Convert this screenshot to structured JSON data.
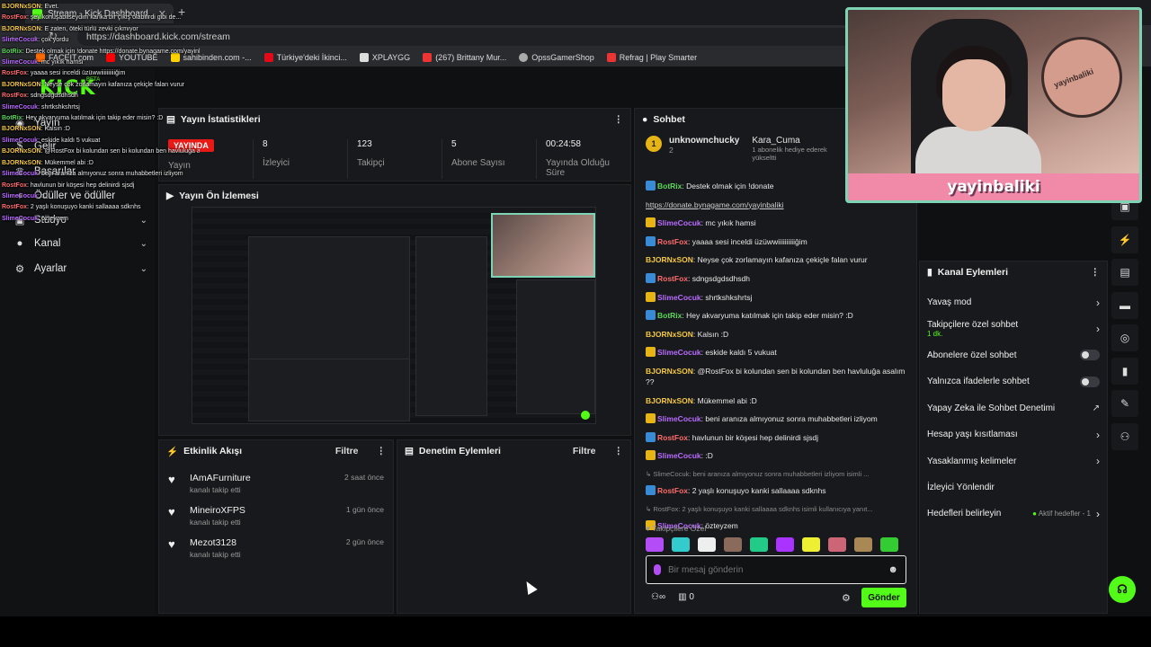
{
  "browser": {
    "tab_title": "Stream - Kick Dashboard",
    "url": "https://dashboard.kick.com/stream",
    "bookmarks": [
      "FACEIT.com",
      "YOUTUBE",
      "sahibinden.com -...",
      "Türkiye'deki İkinci...",
      "XPLAYGG",
      "(267) Brittany Mur...",
      "OpssGamerShop",
      "Refrag | Play Smarter"
    ]
  },
  "logo": {
    "text": "KICK",
    "beta": "BETA"
  },
  "sidebar": {
    "items": [
      {
        "label": "Yayın",
        "icon": "broadcast-icon"
      },
      {
        "label": "Gelir",
        "icon": "wallet-icon"
      },
      {
        "label": "Başarılar",
        "icon": "trophy-icon"
      },
      {
        "label": "Ödüller ve ödüller",
        "icon": "gift-icon"
      },
      {
        "label": "Stüdyo",
        "icon": "studio-icon"
      },
      {
        "label": "Kanal",
        "icon": "user-icon"
      },
      {
        "label": "Ayarlar",
        "icon": "gear-icon"
      }
    ]
  },
  "overlay_chat": [
    {
      "user": "BJORNxSON",
      "text": ": Evet.",
      "color": "#f5c842"
    },
    {
      "user": "RostFox",
      "text": ": şey konuşabilseydim kanka bir çıkış olabilirdi gibi de...",
      "color": "#ff6b6b"
    },
    {
      "user": "BJORNxSON",
      "text": ": E zaten, öteki türlü zevki çıkmıyor",
      "color": "#f5c842"
    },
    {
      "user": "SlimeCocuk",
      "text": ": çok yordu",
      "color": "#b86bff"
    },
    {
      "user": "BotRix",
      "text": ": Destek olmak için !donate https://donate.bynagame.com/yayinbaliki",
      "color": "#5ad65a"
    },
    {
      "user": "SlimeCocuk",
      "text": ": mc yıkık hamsi",
      "color": "#b86bff"
    },
    {
      "user": "RostFox",
      "text": ": yaaaa sesi inceldi üzüwwiiiiiiiiiiğim",
      "color": "#ff6b6b"
    },
    {
      "user": "BJORNxSON",
      "text": ": Neyse çok zorlamayın kafanıza çekiçle falan vurur",
      "color": "#f5c842"
    },
    {
      "user": "RostFox",
      "text": ": sdngsdgdsdhsdh",
      "color": "#ff6b6b"
    },
    {
      "user": "SlimeCocuk",
      "text": ": shrtkshkshrtsj",
      "color": "#b86bff"
    },
    {
      "user": "BotRix",
      "text": ": Hey akvaryuma katılmak için takip eder misin? :D",
      "color": "#5ad65a"
    },
    {
      "user": "BJORNxSON",
      "text": ": Kalsın :D",
      "color": "#f5c842"
    },
    {
      "user": "SlimeCocuk",
      "text": ": eskide kaldı 5 vukuat",
      "color": "#b86bff"
    },
    {
      "user": "BJORNxSON",
      "text": ": @RostFox bi kolundan sen bi kolundan ben havluluğa asalım ??",
      "color": "#f5c842"
    },
    {
      "user": "BJORNxSON",
      "text": ": Mükemmel abi :D",
      "color": "#f5c842"
    },
    {
      "user": "SlimeCocuk",
      "text": ": beni aranıza almıyonuz sonra muhabbetleri izliyom",
      "color": "#b86bff"
    },
    {
      "user": "RostFox",
      "text": ": havlunun bir köşesi hep delinirdi sjsdj",
      "color": "#ff6b6b"
    },
    {
      "user": "SlimeCocuk",
      "text": ": :D",
      "color": "#b86bff"
    },
    {
      "user": "RostFox",
      "text": ": 2 yaşlı konuşuyo kanki sallaaaa sdknhs",
      "color": "#ff6b6b"
    },
    {
      "user": "SlimeCocuk",
      "text": ": özteyzem",
      "color": "#b86bff"
    }
  ],
  "stats_panel": {
    "title": "Yayın İstatistikleri",
    "live_badge": "YAYINDA",
    "live_label": "Yayın",
    "stats": [
      {
        "value": "8",
        "label": "İzleyici"
      },
      {
        "value": "123",
        "label": "Takipçi"
      },
      {
        "value": "5",
        "label": "Abone Sayısı"
      },
      {
        "value": "00:24:58",
        "label": "Yayında Olduğu Süre"
      }
    ]
  },
  "preview_panel": {
    "title": "Yayın Ön İzlemesi"
  },
  "activity_panel": {
    "title": "Etkinlik Akışı",
    "filter": "Filtre",
    "items": [
      {
        "name": "IAmAFurniture",
        "sub": "kanalı takip etti",
        "time": "2 saat önce"
      },
      {
        "name": "MineiroXFPS",
        "sub": "kanalı takip etti",
        "time": "1 gün önce"
      },
      {
        "name": "Mezot3128",
        "sub": "kanalı takip etti",
        "time": "2 gün önce"
      }
    ]
  },
  "moderation_panel": {
    "title": "Denetim Eylemleri",
    "filter": "Filtre"
  },
  "chat": {
    "title": "Sohbet",
    "pinned_user": "unknownchucky",
    "pinned_count": "2",
    "gift_user": "Kara_Cuma",
    "gift_text": "1 abonelik hediye ederek yükseltti",
    "messages": [
      {
        "user": "BotRix",
        "text": ": Destek olmak için !donate",
        "color": "#5ad65a",
        "badge": "#3a8bd6"
      },
      {
        "user": "",
        "text": "https://donate.bynagame.com/yayinbaliki",
        "color": "#5ad65a",
        "badge": "",
        "link": true
      },
      {
        "user": "SlimeCocuk",
        "text": ": mc yıkık hamsi",
        "color": "#b86bff",
        "badge": "#e7b416"
      },
      {
        "user": "RostFox",
        "text": ": yaaaa sesi inceldi üzüwwiiiiiiiiiiğim",
        "color": "#ff6b6b",
        "badge": "#3a8bd6"
      },
      {
        "user": "BJORNxSON",
        "text": ": Neyse çok zorlamayın kafanıza çekiçle falan vurur",
        "color": "#f5c842",
        "badge": ""
      },
      {
        "user": "RostFox",
        "text": ": sdngsdgdsdhsdh",
        "color": "#ff6b6b",
        "badge": "#3a8bd6"
      },
      {
        "user": "SlimeCocuk",
        "text": ": shrtkshkshrtsj",
        "color": "#b86bff",
        "badge": "#e7b416"
      },
      {
        "user": "BotRix",
        "text": ": Hey akvaryuma katılmak için takip eder misin? :D",
        "color": "#5ad65a",
        "badge": "#3a8bd6"
      },
      {
        "user": "BJORNxSON",
        "text": ": Kalsın :D",
        "color": "#f5c842",
        "badge": ""
      },
      {
        "user": "SlimeCocuk",
        "text": ": eskide kaldı 5 vukuat",
        "color": "#b86bff",
        "badge": "#e7b416"
      },
      {
        "user": "BJORNxSON",
        "text": ": @RostFox bi kolundan sen bi kolundan ben havluluğa asalım ??",
        "color": "#f5c842",
        "badge": ""
      },
      {
        "user": "BJORNxSON",
        "text": ": Mükemmel abi :D",
        "color": "#f5c842",
        "badge": ""
      },
      {
        "user": "SlimeCocuk",
        "text": ": beni aranıza almıyonuz sonra muhabbetleri izliyom",
        "color": "#b86bff",
        "badge": "#e7b416"
      },
      {
        "user": "RostFox",
        "text": ": havlunun bir köşesi hep delinirdi sjsdj",
        "color": "#ff6b6b",
        "badge": "#3a8bd6"
      },
      {
        "user": "SlimeCocuk",
        "text": ": :D",
        "color": "#b86bff",
        "badge": "#e7b416"
      },
      {
        "user": "",
        "text": "↳ SlimeCocuk: beni aranıza almıyonuz sonra muhabbetleri izliyom isimli ...",
        "color": "",
        "badge": "",
        "reply": true
      },
      {
        "user": "RostFox",
        "text": ": 2 yaşlı konuşuyo kanki sallaaaa sdknhs",
        "color": "#ff6b6b",
        "badge": "#3a8bd6"
      },
      {
        "user": "",
        "text": "↳ RostFox: 2 yaşlı konuşuyo kanki sallaaaa sdknhs isimli kullanıcıya yanıt...",
        "color": "",
        "badge": "",
        "reply": true
      },
      {
        "user": "SlimeCocuk",
        "text": ": özteyzem",
        "color": "#b86bff",
        "badge": "#e7b416"
      }
    ],
    "followers_only_label": "Takipçilere Özel",
    "input_placeholder": "Bir mesaj gönderin",
    "points": "0",
    "send_label": "Gönder"
  },
  "channel_actions": {
    "title": "Kanal Eylemleri",
    "rows": [
      {
        "label": "Yavaş mod",
        "type": "chevron"
      },
      {
        "label": "Takipçilere özel sohbet",
        "sub": "1 dk.",
        "type": "chevron"
      },
      {
        "label": "Abonelere özel sohbet",
        "type": "toggle"
      },
      {
        "label": "Yalnızca ifadelerle sohbet",
        "type": "toggle"
      },
      {
        "label": "Yapay Zeka ile Sohbet Denetimi",
        "type": "external"
      },
      {
        "label": "Hesap yaşı kısıtlaması",
        "type": "chevron"
      },
      {
        "label": "Yasaklanmış kelimeler",
        "type": "chevron"
      },
      {
        "label": "İzleyici Yönlendir",
        "type": "none"
      },
      {
        "label": "Hedefleri belirleyin",
        "type": "goal",
        "extra": "Aktif hedefler - 1"
      }
    ]
  },
  "webcam": {
    "banner": "yayinbaliki",
    "plaque": "yayinbaliki"
  }
}
